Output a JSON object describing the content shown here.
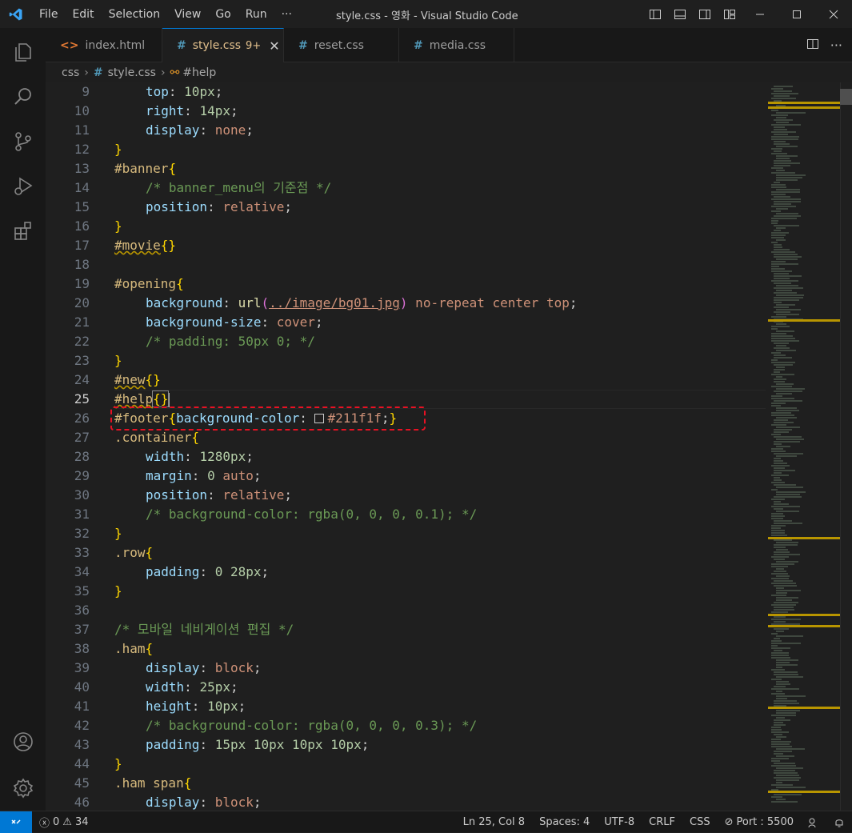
{
  "titlebar": {
    "menu": [
      "File",
      "Edit",
      "Selection",
      "View",
      "Go",
      "Run",
      "···"
    ],
    "window_title": "style.css - 영화 - Visual Studio Code"
  },
  "tabs": [
    {
      "icon": "<>",
      "label": "index.html",
      "active": false
    },
    {
      "icon": "#",
      "label": "style.css",
      "badge": "9+",
      "active": true
    },
    {
      "icon": "#",
      "label": "reset.css",
      "active": false
    },
    {
      "icon": "#",
      "label": "media.css",
      "active": false
    }
  ],
  "breadcrumb": {
    "folder": "css",
    "file": "style.css",
    "symbol": "#help"
  },
  "editor": {
    "current_line": 25,
    "lines": [
      {
        "n": "9"
      },
      {
        "n": "10"
      },
      {
        "n": "11"
      },
      {
        "n": "12"
      },
      {
        "n": "13"
      },
      {
        "n": "14"
      },
      {
        "n": "15"
      },
      {
        "n": "16"
      },
      {
        "n": "17"
      },
      {
        "n": "18"
      },
      {
        "n": "19"
      },
      {
        "n": "20"
      },
      {
        "n": "21"
      },
      {
        "n": "22"
      },
      {
        "n": "23"
      },
      {
        "n": "24"
      },
      {
        "n": "25"
      },
      {
        "n": "26"
      },
      {
        "n": "27"
      },
      {
        "n": "28"
      },
      {
        "n": "29"
      },
      {
        "n": "30"
      },
      {
        "n": "31"
      },
      {
        "n": "32"
      },
      {
        "n": "33"
      },
      {
        "n": "34"
      },
      {
        "n": "35"
      },
      {
        "n": "36"
      },
      {
        "n": "37"
      },
      {
        "n": "38"
      },
      {
        "n": "39"
      },
      {
        "n": "40"
      },
      {
        "n": "41"
      },
      {
        "n": "42"
      },
      {
        "n": "43"
      },
      {
        "n": "44"
      },
      {
        "n": "45"
      },
      {
        "n": "46"
      }
    ],
    "code": {
      "l9": [
        "top",
        ": ",
        "10px",
        ";"
      ],
      "l10": [
        "right",
        ": ",
        "14px",
        ";"
      ],
      "l11": [
        "display",
        ": ",
        "none",
        ";"
      ],
      "l12": "}",
      "l13": [
        "#banner",
        "{"
      ],
      "l14": "/* banner_menu의 기준점 */",
      "l15": [
        "position",
        ": ",
        "relative",
        ";"
      ],
      "l16": "}",
      "l17": [
        "#movie",
        "{}"
      ],
      "l19": [
        "#opening",
        "{"
      ],
      "l20": [
        "background",
        ": ",
        "url",
        "(",
        "../image/bg01.jpg",
        ")",
        " no-repeat center top",
        ";"
      ],
      "l21": [
        "background-size",
        ": ",
        "cover",
        ";"
      ],
      "l22": "/* padding: 50px 0; */",
      "l23": "}",
      "l24": [
        "#new",
        "{}"
      ],
      "l25": [
        "#help",
        "{}"
      ],
      "l26": [
        "#footer",
        "{",
        "background-color",
        ": ",
        "#211f1f",
        ";",
        "}"
      ],
      "l27": [
        ".container",
        "{"
      ],
      "l28": [
        "width",
        ": ",
        "1280px",
        ";"
      ],
      "l29": [
        "margin",
        ": ",
        "0",
        " auto",
        ";"
      ],
      "l30": [
        "position",
        ": ",
        "relative",
        ";"
      ],
      "l31": "/* background-color: rgba(0, 0, 0, 0.1); */",
      "l32": "}",
      "l33": [
        ".row",
        "{"
      ],
      "l34": [
        "padding",
        ": ",
        "0 28px",
        ";"
      ],
      "l35": "}",
      "l37": "/* 모바일 네비게이션 편집 */",
      "l38": [
        ".ham",
        "{"
      ],
      "l39": [
        "display",
        ": ",
        "block",
        ";"
      ],
      "l40": [
        "width",
        ": ",
        "25px",
        ";"
      ],
      "l41": [
        "height",
        ": ",
        "10px",
        ";"
      ],
      "l42": "/* background-color: rgba(0, 0, 0, 0.3); */",
      "l43": [
        "padding",
        ": ",
        "15px 10px 10px 10px",
        ";"
      ],
      "l44": "}",
      "l45": [
        ".ham span",
        "{"
      ],
      "l46": [
        "display",
        ": ",
        "block",
        ";"
      ]
    },
    "footer_color": "#211f1f"
  },
  "statusbar": {
    "errors": "0",
    "warnings": "34",
    "position": "Ln 25, Col 8",
    "spaces": "Spaces: 4",
    "encoding": "UTF-8",
    "eol": "CRLF",
    "language": "CSS",
    "port": "Port : 5500"
  },
  "colors": {
    "accent": "#0078d4",
    "highlight_box": "#e81123",
    "modified_tab": "#e2c08d"
  }
}
